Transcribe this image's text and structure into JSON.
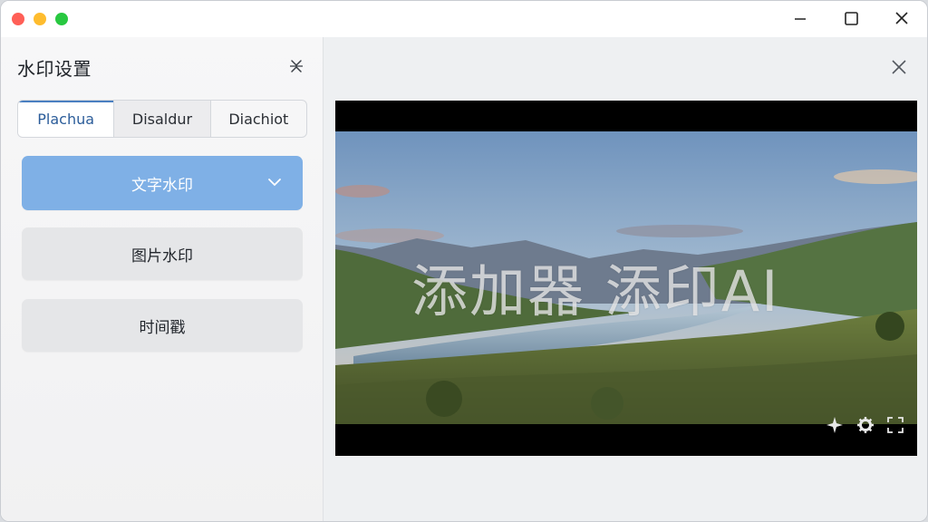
{
  "sidebar": {
    "title": "水印设置",
    "tabs": [
      {
        "label": "Plachua",
        "active": true
      },
      {
        "label": "Disaldur",
        "active": false
      },
      {
        "label": "Diachiot",
        "active": false
      }
    ],
    "buttons": {
      "text_watermark": "文字水印",
      "image_watermark": "图片水印",
      "timestamp": "时间戳"
    }
  },
  "preview": {
    "watermark_text": "添加器 添印AI"
  },
  "icons": {
    "pin": "collapse-pin-icon",
    "dropdown": "chevron-down-icon",
    "close_panel": "close-icon",
    "video_controls": [
      "sparkle-icon",
      "gear-icon",
      "fullscreen-icon"
    ]
  },
  "colors": {
    "primary_button": "#7fb0e6",
    "active_tab_text": "#2c5d9a"
  }
}
